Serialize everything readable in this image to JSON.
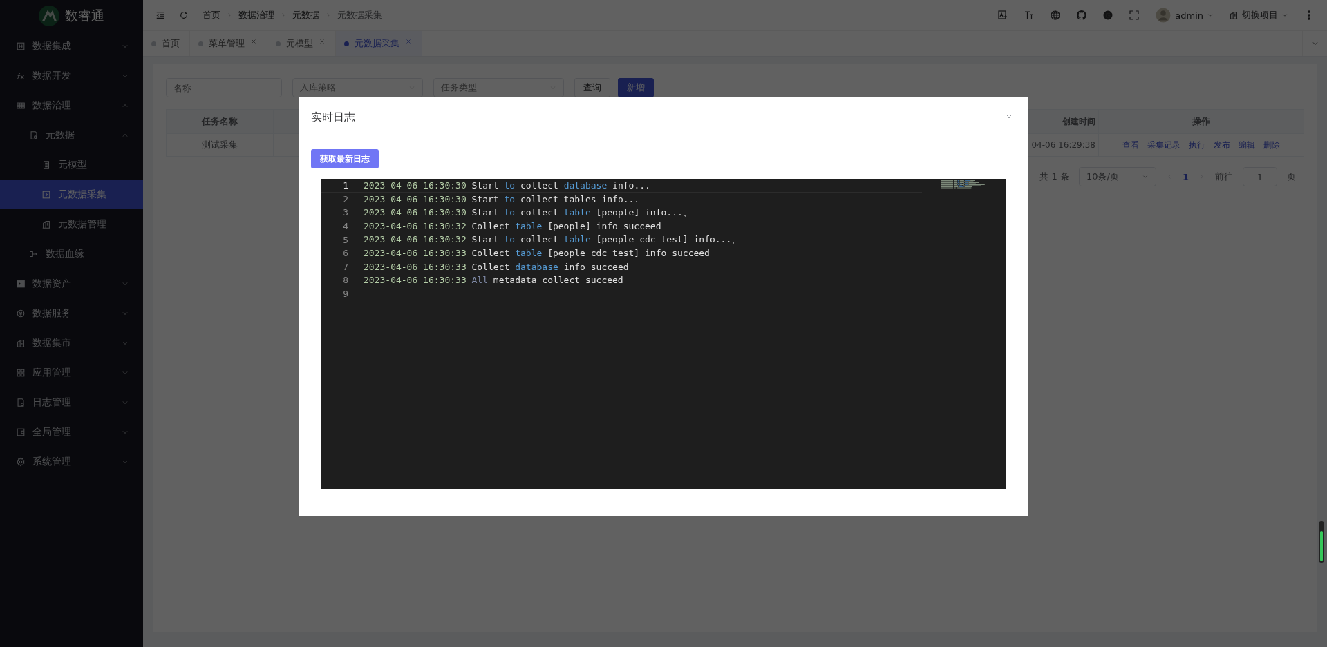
{
  "app": {
    "name": "数睿通"
  },
  "sidebar": {
    "items": [
      {
        "label": "数据集成",
        "kind": "integration",
        "expanded": false,
        "selected": false
      },
      {
        "label": "数据开发",
        "kind": "fx",
        "expanded": false,
        "selected": false
      },
      {
        "label": "数据治理",
        "kind": "grid",
        "expanded": true,
        "selected": false,
        "children": [
          {
            "label": "元数据",
            "kind": "doc",
            "expanded": true,
            "selected": false,
            "children": [
              {
                "label": "元模型",
                "kind": "list",
                "selected": false
              },
              {
                "label": "元数据采集",
                "kind": "play",
                "selected": true
              },
              {
                "label": "元数据管理",
                "kind": "building",
                "selected": false
              }
            ]
          },
          {
            "label": "数据血缘",
            "kind": "lineage",
            "selected": false
          }
        ]
      },
      {
        "label": "数据资产",
        "kind": "terminal",
        "expanded": false,
        "selected": false
      },
      {
        "label": "数据服务",
        "kind": "coin",
        "expanded": false,
        "selected": false
      },
      {
        "label": "数据集市",
        "kind": "building",
        "expanded": false,
        "selected": false
      },
      {
        "label": "应用管理",
        "kind": "apps",
        "expanded": false,
        "selected": false
      },
      {
        "label": "日志管理",
        "kind": "doc",
        "expanded": false,
        "selected": false
      },
      {
        "label": "全局管理",
        "kind": "wallet",
        "expanded": false,
        "selected": false
      },
      {
        "label": "系统管理",
        "kind": "gear",
        "expanded": false,
        "selected": false
      }
    ]
  },
  "breadcrumb": [
    "首页",
    "数据治理",
    "元数据",
    "元数据采集"
  ],
  "user": {
    "name": "admin",
    "expanded": false
  },
  "project_switch": {
    "label": "切换项目",
    "expanded": false
  },
  "tabs": [
    {
      "label": "首页",
      "closable": false,
      "selected": false
    },
    {
      "label": "菜单管理",
      "closable": true,
      "selected": false
    },
    {
      "label": "元模型",
      "closable": true,
      "selected": false
    },
    {
      "label": "元数据采集",
      "closable": true,
      "selected": true
    }
  ],
  "filters": {
    "name": {
      "placeholder": "名称"
    },
    "strategy": {
      "placeholder": "入库策略"
    },
    "task_type": {
      "placeholder": "任务类型"
    },
    "query_button": "查询",
    "add_button": "新增"
  },
  "table": {
    "columns": [
      "任务名称",
      "创建时间",
      "操作"
    ],
    "rows": [
      {
        "name": "测试采集",
        "created": "04-06 16:29:38",
        "actions": [
          "查看",
          "采集记录",
          "执行",
          "发布",
          "编辑",
          "删除"
        ]
      }
    ]
  },
  "pagination": {
    "total": "共 1 条",
    "page_size": "10条/页",
    "pages": [
      {
        "label": "1",
        "selected": true
      }
    ],
    "goto_label": "前往",
    "goto_value": "1",
    "page_suffix": "页"
  },
  "dialog": {
    "title": "实时日志",
    "refresh_button": "获取最新日志",
    "log_lines": [
      {
        "number": "1",
        "current": true,
        "segments": [
          {
            "text": "2023-04-06 16:30:30",
            "kind": "time"
          },
          {
            "text": "Start",
            "kind": "plain"
          },
          {
            "text": "to",
            "kind": "keyword"
          },
          {
            "text": "collect",
            "kind": "plain"
          },
          {
            "text": "database",
            "kind": "keyword"
          },
          {
            "text": "info...",
            "kind": "plain"
          }
        ]
      },
      {
        "number": "2",
        "current": false,
        "segments": [
          {
            "text": "2023-04-06 16:30:30",
            "kind": "time"
          },
          {
            "text": "Start",
            "kind": "plain"
          },
          {
            "text": "to",
            "kind": "keyword"
          },
          {
            "text": "collect tables info...",
            "kind": "plain"
          }
        ]
      },
      {
        "number": "3",
        "current": false,
        "segments": [
          {
            "text": "2023-04-06 16:30:30",
            "kind": "time"
          },
          {
            "text": "Start",
            "kind": "plain"
          },
          {
            "text": "to",
            "kind": "keyword"
          },
          {
            "text": "collect",
            "kind": "plain"
          },
          {
            "text": "table",
            "kind": "keyword"
          },
          {
            "text": "[people] info...、",
            "kind": "plain"
          }
        ]
      },
      {
        "number": "4",
        "current": false,
        "segments": [
          {
            "text": "2023-04-06 16:30:32",
            "kind": "time"
          },
          {
            "text": "Collect",
            "kind": "plain"
          },
          {
            "text": "table",
            "kind": "keyword"
          },
          {
            "text": "[people] info succeed",
            "kind": "plain"
          }
        ]
      },
      {
        "number": "5",
        "current": false,
        "segments": [
          {
            "text": "2023-04-06 16:30:32",
            "kind": "time"
          },
          {
            "text": "Start",
            "kind": "plain"
          },
          {
            "text": "to",
            "kind": "keyword"
          },
          {
            "text": "collect",
            "kind": "plain"
          },
          {
            "text": "table",
            "kind": "keyword"
          },
          {
            "text": "[people_cdc_test] info...、",
            "kind": "plain"
          }
        ]
      },
      {
        "number": "6",
        "current": false,
        "segments": [
          {
            "text": "2023-04-06 16:30:33",
            "kind": "time"
          },
          {
            "text": "Collect",
            "kind": "plain"
          },
          {
            "text": "table",
            "kind": "keyword"
          },
          {
            "text": "[people_cdc_test] info succeed",
            "kind": "plain"
          }
        ]
      },
      {
        "number": "7",
        "current": false,
        "segments": [
          {
            "text": "2023-04-06 16:30:33",
            "kind": "time"
          },
          {
            "text": "Collect",
            "kind": "plain"
          },
          {
            "text": "database",
            "kind": "keyword"
          },
          {
            "text": "info succeed",
            "kind": "plain"
          }
        ]
      },
      {
        "number": "8",
        "current": false,
        "segments": [
          {
            "text": "2023-04-06 16:30:33",
            "kind": "time"
          },
          {
            "text": "All",
            "kind": "muted"
          },
          {
            "text": "metadata collect succeed",
            "kind": "plain"
          }
        ]
      },
      {
        "number": "9",
        "current": false
      }
    ]
  }
}
